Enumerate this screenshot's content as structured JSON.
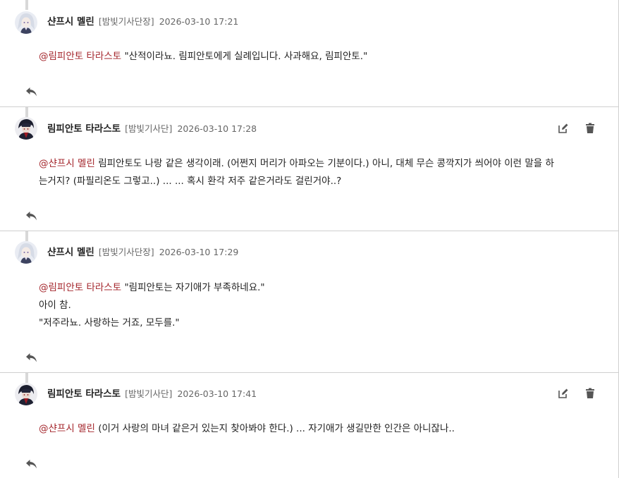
{
  "comments": [
    {
      "author": "샨프시 멜린",
      "role": "[밤빛기사단장]",
      "time": "2026-03-10 17:21",
      "mention": "@림피안토 타라스토",
      "lines": [
        "\"산적이라뇨. 림피안토에게 실례입니다. 사과해요, 림피안토.\""
      ],
      "has_actions": false
    },
    {
      "author": "림피안토 타라스토",
      "role": "[밤빛기사단]",
      "time": "2026-03-10 17:28",
      "mention": "@샨프시 멜린",
      "lines": [
        "림피안토도 나랑 같은 생각이래. (어쩐지 머리가 아파오는 기분이다.) 아니, 대체 무슨 콩깍지가 씌어야 이런 말을 하",
        "는거지? (파필리온도 그렇고..) ... ... 혹시 환각 저주 같은거라도 걸린거야..?"
      ],
      "has_actions": true
    },
    {
      "author": "샨프시 멜린",
      "role": "[밤빛기사단장]",
      "time": "2026-03-10 17:29",
      "mention": "@림피안토 타라스토",
      "lines": [
        "\"림피안토는 자기애가 부족하네요.\"",
        "아이 참.",
        "\"저주라뇨. 사랑하는 거죠, 모두를.\""
      ],
      "has_actions": false
    },
    {
      "author": "림피안토 타라스토",
      "role": "[밤빛기사단]",
      "time": "2026-03-10 17:41",
      "mention": "@샨프시 멜린",
      "lines": [
        "(이거 사랑의 마녀 같은거 있는지 찾아봐야 한다.) ... 자기애가 생길만한 인간은 아니잖나.."
      ],
      "has_actions": true
    }
  ],
  "icons": {
    "reply": "reply-icon",
    "edit": "edit-icon",
    "delete": "trash-icon",
    "avatar_melin": "avatar-white-hair",
    "avatar_limpianto": "avatar-dark-knight"
  },
  "colors": {
    "mention": "#a4262c",
    "text": "#222222",
    "muted": "#666666",
    "icon": "#555555",
    "divider": "#cfcfcf"
  }
}
